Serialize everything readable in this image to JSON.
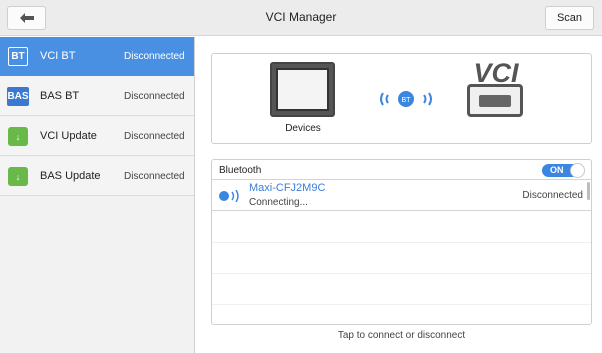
{
  "header": {
    "title": "VCI Manager",
    "scan_label": "Scan"
  },
  "sidebar": {
    "items": [
      {
        "icon_text": "BT",
        "label": "VCI BT",
        "status": "Disconnected",
        "active": true
      },
      {
        "icon_text": "BAS",
        "label": "BAS BT",
        "status": "Disconnected",
        "active": false
      },
      {
        "icon_text": "↓",
        "label": "VCI Update",
        "status": "Disconnected",
        "active": false
      },
      {
        "icon_text": "↓",
        "label": "BAS Update",
        "status": "Disconnected",
        "active": false
      }
    ]
  },
  "devices_panel": {
    "devices_label": "Devices",
    "vci_logo_text": "VCI",
    "signal_text": "BT"
  },
  "bluetooth": {
    "title": "Bluetooth",
    "toggle_label": "ON",
    "device": {
      "name": "Maxi-CFJ2M9C",
      "sub": "Connecting...",
      "status": "Disconnected"
    }
  },
  "footer": {
    "hint": "Tap to connect or disconnect"
  },
  "colors": {
    "accent": "#4a90e2",
    "update_green": "#69b94a",
    "device_blue": "#3a7ed8"
  }
}
